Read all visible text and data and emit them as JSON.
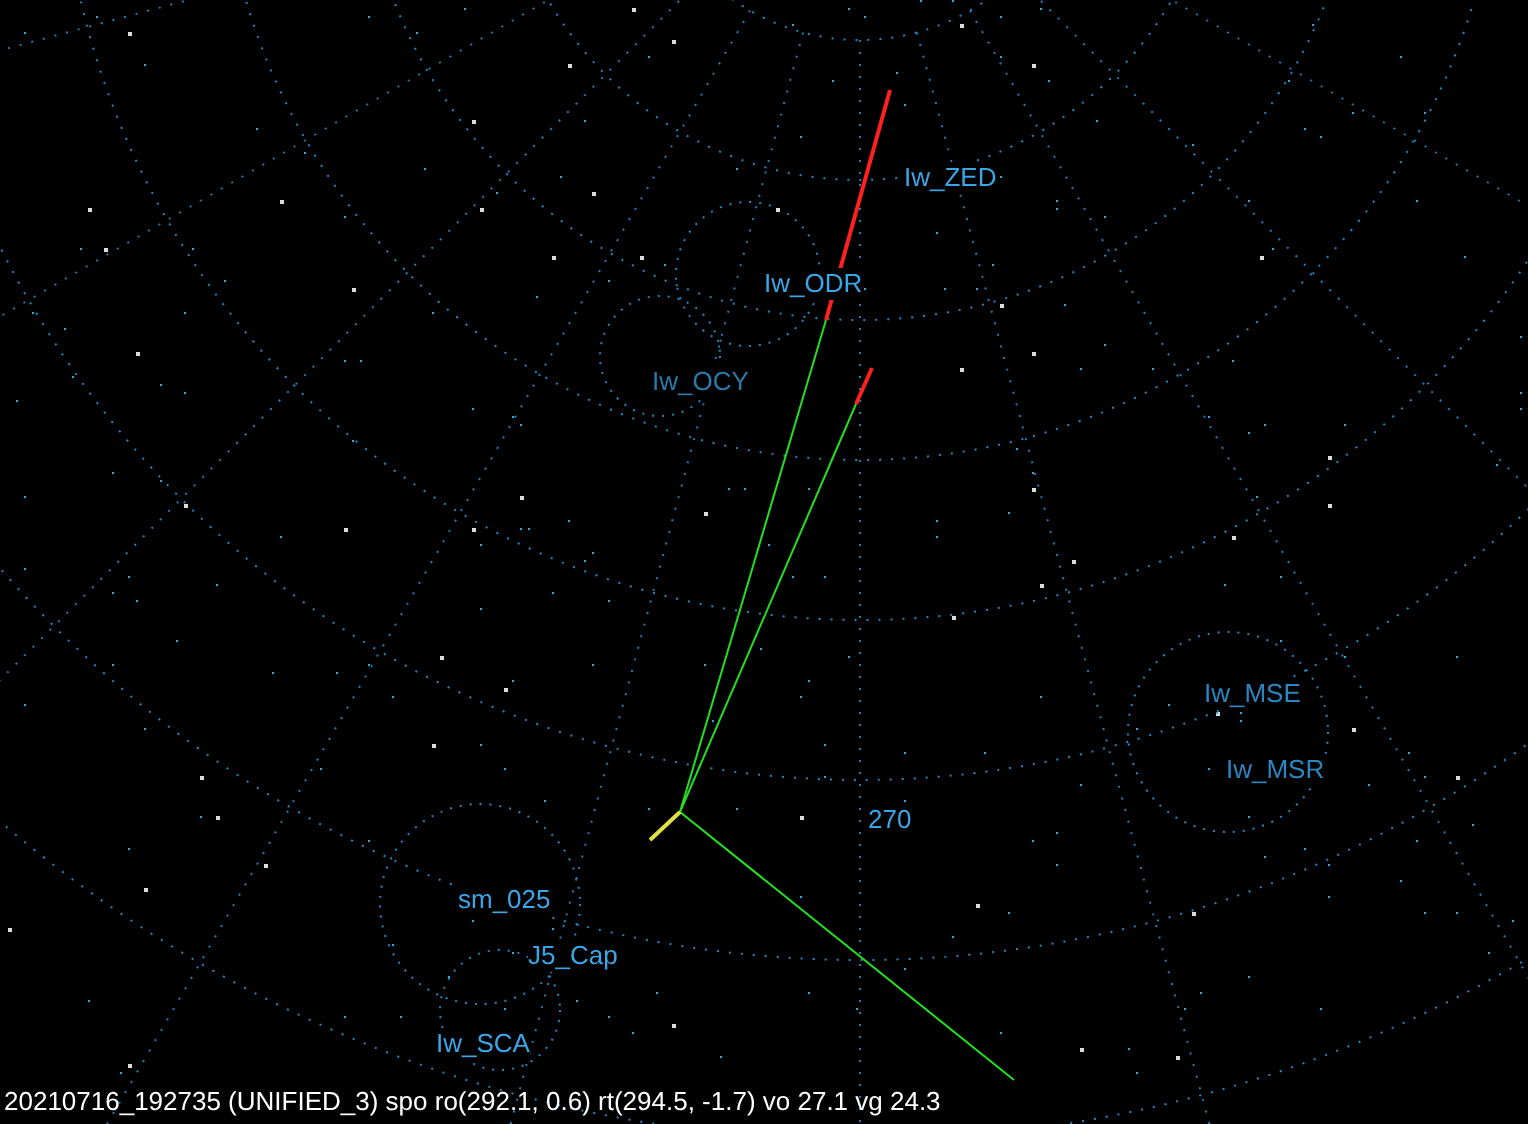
{
  "labels": [
    {
      "text": "Iw_ZED",
      "color": "#3aa6e8"
    },
    {
      "text": "Iw_ODR",
      "color": "#3aa6e8"
    },
    {
      "text": "Iw_OCY",
      "color": "#2a7aa8"
    },
    {
      "text": "Iw_MSE",
      "color": "#2a86c0"
    },
    {
      "text": "Iw_MSR",
      "color": "#2a86c0"
    },
    {
      "text": "270",
      "color": "#3aa6e8"
    },
    {
      "text": "sm_025",
      "color": "#3aa6e8"
    },
    {
      "text": "J5_Cap",
      "color": "#3aa6e8"
    },
    {
      "text": "Iw_SCA",
      "color": "#3aa6e8"
    }
  ],
  "status_bar": "20210716_192735 (UNIFIED_3) spo ro(292.1, 0.6) rt(294.5, -1.7) vo 27.1 vg 24.3"
}
